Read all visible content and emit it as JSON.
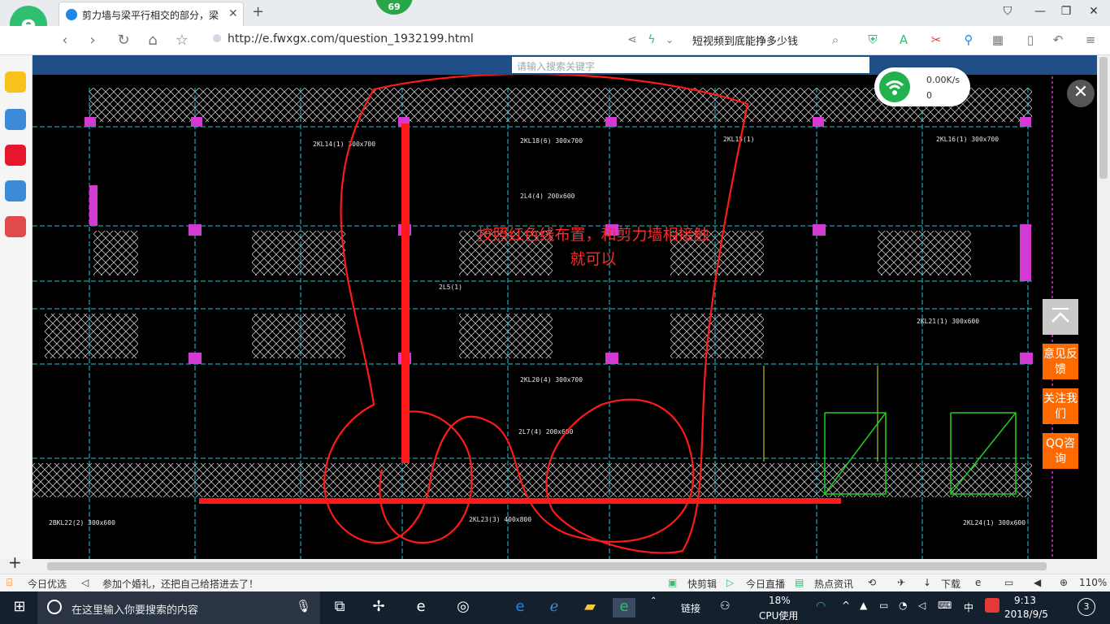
{
  "browser": {
    "tab_title": "剪力墙与梁平行相交的部分，梁是",
    "badge": "69",
    "url": "http://e.fwxgx.com/question_1932199.html",
    "search_query": "短视频到底能挣多少钱"
  },
  "page": {
    "site_search_placeholder": "请输入搜索关键字",
    "note_line1": "按照红色线布置，和剪力墙相接触",
    "note_line2": "就可以",
    "net_speed": "0.00K/s",
    "net_count": "0",
    "feedback_label": "意见反馈",
    "follow_label": "关注我们",
    "qq_label": "QQ咨询",
    "cad_labels": [
      "2KL14(1) 300x700",
      "2KL15(1)",
      "2KL16(1) 300x700",
      "2KL18(6) 300x700",
      "2KL20(4) 300x700",
      "2L7(4) 200x600",
      "2KL23(3) 400x800",
      "2BKL22(2) 300x600",
      "2KL24(1) 300x600",
      "2KL21(1) 300x600",
      "2L5(1)",
      "2L4(4) 200x600"
    ]
  },
  "statusbar": {
    "today_pick": "今日优选",
    "news": "参加个婚礼，还把自己给搭进去了！",
    "quick_clip": "快剪辑",
    "today_live": "今日直播",
    "hot_news": "热点资讯",
    "download": "下载",
    "zoom": "110%"
  },
  "taskbar": {
    "search_placeholder": "在这里输入你要搜索的内容",
    "link_label": "链接",
    "cpu_percent": "18%",
    "cpu_label": "CPU使用",
    "ime": "中",
    "time": "9:13",
    "date": "2018/9/5",
    "notif_count": "3"
  }
}
